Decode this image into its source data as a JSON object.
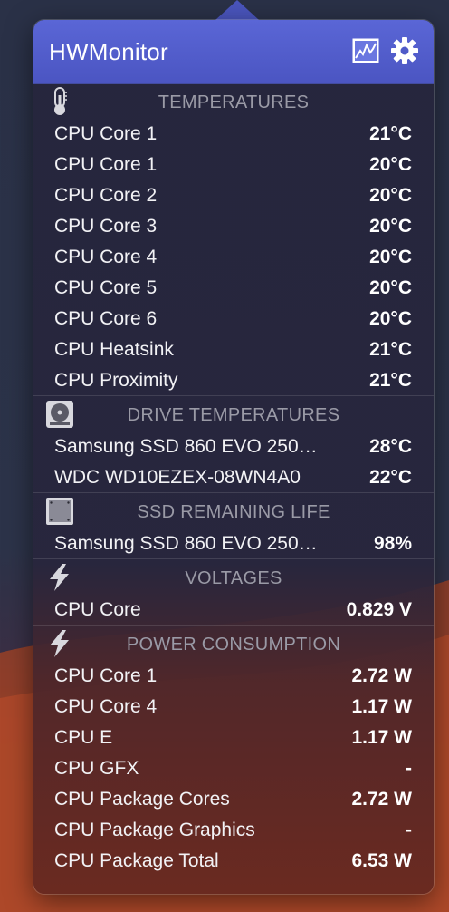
{
  "app": {
    "title": "HWMonitor",
    "header_icons": [
      "graph-icon",
      "gear-icon"
    ]
  },
  "colors": {
    "header": "#4b55c2",
    "section_title": "#9a9aa6",
    "text": "#f2f2f5"
  },
  "sections": {
    "temperatures": {
      "title": "TEMPERATURES",
      "icon": "thermometer-icon",
      "rows": [
        {
          "label": "CPU Core 1",
          "value": "21°C"
        },
        {
          "label": "CPU Core 1",
          "value": "20°C"
        },
        {
          "label": "CPU Core 2",
          "value": "20°C"
        },
        {
          "label": "CPU Core 3",
          "value": "20°C"
        },
        {
          "label": "CPU Core 4",
          "value": "20°C"
        },
        {
          "label": "CPU Core 5",
          "value": "20°C"
        },
        {
          "label": "CPU Core 6",
          "value": "20°C"
        },
        {
          "label": "CPU Heatsink",
          "value": "21°C"
        },
        {
          "label": "CPU Proximity",
          "value": "21°C"
        }
      ]
    },
    "drive_temperatures": {
      "title": "DRIVE TEMPERATURES",
      "icon": "hard-drive-icon",
      "rows": [
        {
          "label": "Samsung SSD 860 EVO 250…",
          "value": "28°C"
        },
        {
          "label": "WDC WD10EZEX-08WN4A0",
          "value": "22°C"
        }
      ]
    },
    "ssd_remaining_life": {
      "title": "SSD REMAINING LIFE",
      "icon": "ssd-icon",
      "rows": [
        {
          "label": "Samsung SSD 860 EVO 250…",
          "value": "98%"
        }
      ]
    },
    "voltages": {
      "title": "VOLTAGES",
      "icon": "lightning-icon",
      "rows": [
        {
          "label": "CPU Core",
          "value": "0.829 V"
        }
      ]
    },
    "power_consumption": {
      "title": "POWER CONSUMPTION",
      "icon": "lightning-icon",
      "rows": [
        {
          "label": "CPU Core 1",
          "value": "2.72 W"
        },
        {
          "label": "CPU Core 4",
          "value": "1.17 W"
        },
        {
          "label": "CPU E",
          "value": "1.17 W"
        },
        {
          "label": "CPU GFX",
          "value": "-"
        },
        {
          "label": "CPU Package Cores",
          "value": "2.72 W"
        },
        {
          "label": "CPU Package Graphics",
          "value": "-"
        },
        {
          "label": "CPU Package Total",
          "value": "6.53 W"
        }
      ]
    }
  }
}
